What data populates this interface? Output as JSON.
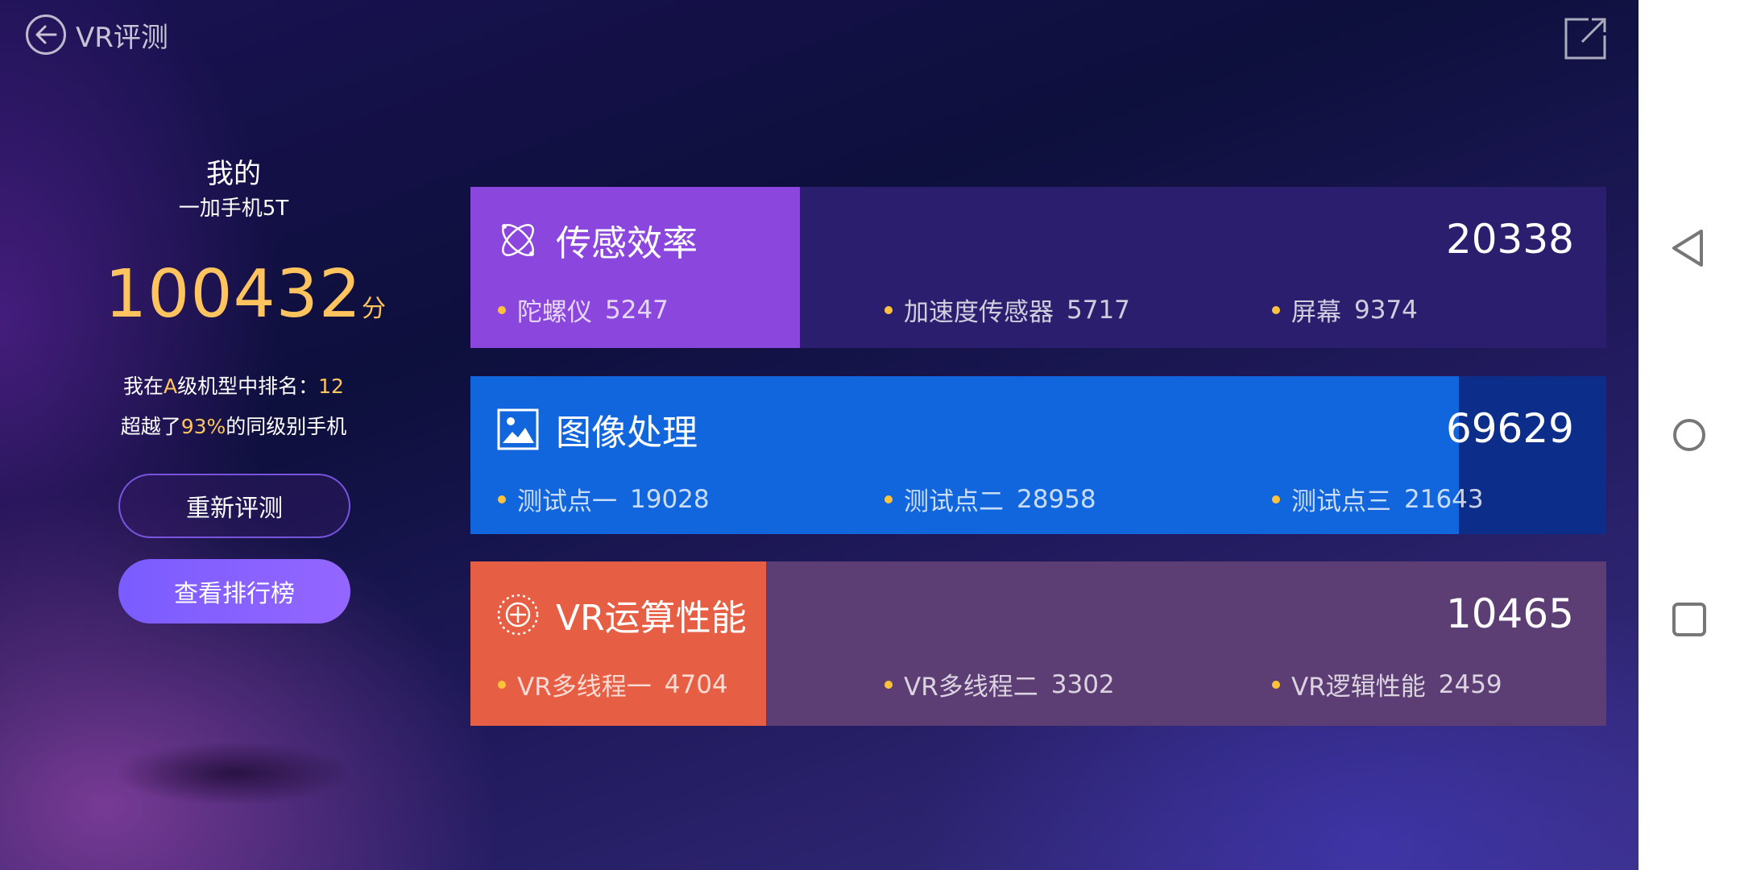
{
  "header": {
    "title": "VR评测",
    "back_icon": "back-arrow-icon",
    "share_icon": "share-icon"
  },
  "summary": {
    "my_label": "我的",
    "device": "一加手机5T",
    "score": "100432",
    "score_unit": "分",
    "rank_prefix": "我在",
    "rank_class": "A",
    "rank_middle": "级机型中排名：",
    "rank_value": "12",
    "exceed_prefix": "超越了",
    "exceed_percent": "93%",
    "exceed_suffix": "的同级别手机",
    "retest_label": "重新评测",
    "ranking_label": "查看排行榜"
  },
  "cards": [
    {
      "title": "传感效率",
      "total": "20338",
      "icon": "atom-icon",
      "fill_fraction": 0.29,
      "fill_color": "#8b46de",
      "bg_color": "#2c1e6e",
      "items": [
        {
          "label": "陀螺仪",
          "value": "5247"
        },
        {
          "label": "加速度传感器",
          "value": "5717"
        },
        {
          "label": "屏幕",
          "value": "9374"
        }
      ]
    },
    {
      "title": "图像处理",
      "total": "69629",
      "icon": "image-icon",
      "fill_fraction": 0.87,
      "fill_color": "#1166dd",
      "bg_color": "#0c2d8a",
      "items": [
        {
          "label": "测试点一",
          "value": "19028"
        },
        {
          "label": "测试点二",
          "value": "28958"
        },
        {
          "label": "测试点三",
          "value": "21643"
        }
      ]
    },
    {
      "title": "VR运算性能",
      "total": "10465",
      "icon": "crosshair-circle-icon",
      "fill_fraction": 0.26,
      "fill_color": "#e65e43",
      "bg_color": "#5c3d74",
      "items": [
        {
          "label": "VR多线程一",
          "value": "4704"
        },
        {
          "label": "VR多线程二",
          "value": "3302"
        },
        {
          "label": "VR逻辑性能",
          "value": "2459"
        }
      ]
    }
  ],
  "navbar": {
    "back_icon": "nav-back-triangle-icon",
    "home_icon": "nav-home-circle-icon",
    "recents_icon": "nav-recents-square-icon"
  }
}
